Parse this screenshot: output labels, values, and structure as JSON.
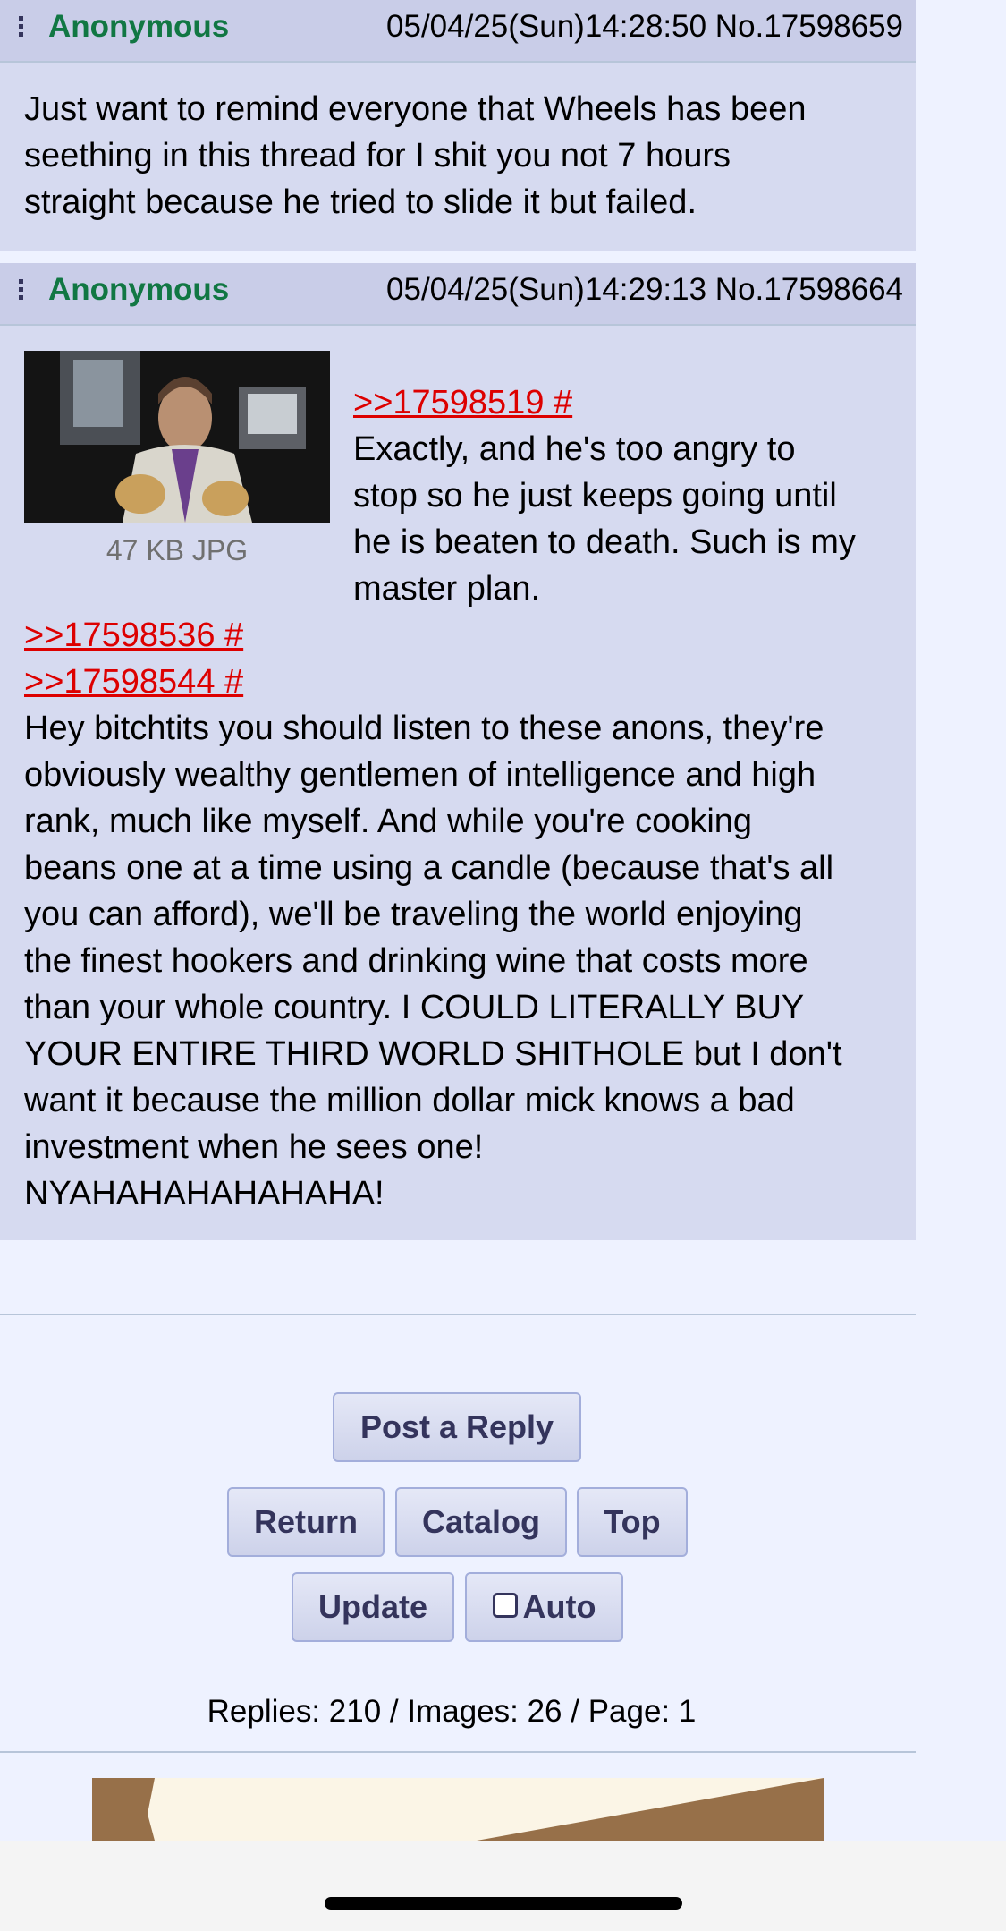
{
  "posts": [
    {
      "name": "Anonymous",
      "datetime": "05/04/25(Sun)14:28:50 No.17598659",
      "comment_lines": [
        "Just want to remind everyone that Wheels has been",
        "seething in this thread for I shit you not 7 hours",
        "straight because he tried to slide it but failed."
      ]
    },
    {
      "name": "Anonymous",
      "datetime": "05/04/25(Sun)14:29:13 No.17598664",
      "file_info": "47 KB JPG",
      "quote_1": ">>17598519 #",
      "side_lines": [
        "Exactly, and he's too angry to",
        "stop so he just keeps going until",
        "he is beaten to death. Such is my",
        "master plan."
      ],
      "quote_2": ">>17598536 #",
      "quote_3": ">>17598544 #",
      "body_lines": [
        "Hey bitchtits you should listen to these anons, they're",
        "obviously wealthy gentlemen of intelligence and high",
        "rank, much like myself. And while you're cooking",
        "beans one at a time using a candle (because that's all",
        "you can afford), we'll be traveling the world enjoying",
        "the finest hookers and drinking wine that costs more",
        "than your whole country. I COULD LITERALLY BUY",
        "YOUR ENTIRE THIRD WORLD SHITHOLE but I don't",
        "want it because the million dollar mick knows a bad",
        "investment when he sees one!",
        "NYAHAHAHAHAHAHA!"
      ]
    }
  ],
  "buttons": {
    "post_reply": "Post a Reply",
    "return": "Return",
    "catalog": "Catalog",
    "top": "Top",
    "update": "Update",
    "auto": "Auto"
  },
  "stats": "Replies: 210 / Images: 26 / Page: 1",
  "colors": {
    "name_green": "#117743",
    "quote_red": "#dd0000",
    "post_bg": "#d6daf0",
    "page_bg": "#eef2ff"
  },
  "icons": [
    "kebab-menu-icon",
    "checkbox-icon"
  ]
}
